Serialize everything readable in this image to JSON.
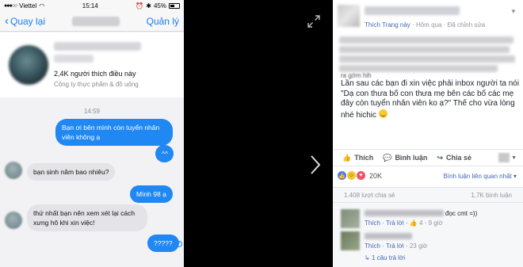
{
  "phone": {
    "status": {
      "carrier": "Viettel",
      "time": "15:14",
      "battery": "45%"
    },
    "nav": {
      "back_label": "Quay lại",
      "manage_label": "Quản lý"
    },
    "page": {
      "likes": "2,4K người thích điều này",
      "category": "Công ty thực phẩm & đồ uống"
    },
    "timestamp": "14:59",
    "messages": [
      {
        "dir": "out",
        "text": "Bạn ơi bên mình còn tuyển nhân viên không ạ"
      },
      {
        "dir": "out",
        "text": "^^"
      },
      {
        "dir": "in",
        "text": "bạn sinh năm bao nhiêu?"
      },
      {
        "dir": "out",
        "text": "Mình 98 ạ"
      },
      {
        "dir": "in",
        "text": "thứ nhất bạn nên xem xét lại cách xưng hô khi  xin việc!"
      },
      {
        "dir": "out",
        "text": "?????"
      }
    ]
  },
  "post": {
    "meta": {
      "like_page": "Thích Trang này",
      "sep": "·",
      "when": "Hôm qua",
      "privacy": "Đã chỉnh sửa"
    },
    "body_tail": "ra gớm hih",
    "body": "Lần sau các bạn đi xin việc phải inbox người ta nói \"Dạ con thưa bố con thưa mẹ bên các bố các mẹ đây còn tuyển nhân viên ko ạ?\" Thế cho vừa lòng nhé hichic",
    "actions": {
      "like": "Thích",
      "comment": "Bình luận",
      "share": "Chia sẻ"
    },
    "reactions_count": "20K",
    "relevant_label": "Bình luận liên quan nhất",
    "shares": "1.408 lượt chia sẻ",
    "comments_count": "1,7K bình luận",
    "comments": [
      {
        "text_tail": "đọc cmt =))",
        "like": "Thích",
        "reply": "Trả lời",
        "count": "4",
        "time": "9 giờ"
      },
      {
        "like": "Thích",
        "reply": "Trả lời",
        "time": "23 giờ",
        "replies": "1 câu trả lời"
      }
    ]
  },
  "colors": {
    "messenger_blue": "#1f88f2",
    "fb_link": "#4267b2"
  }
}
